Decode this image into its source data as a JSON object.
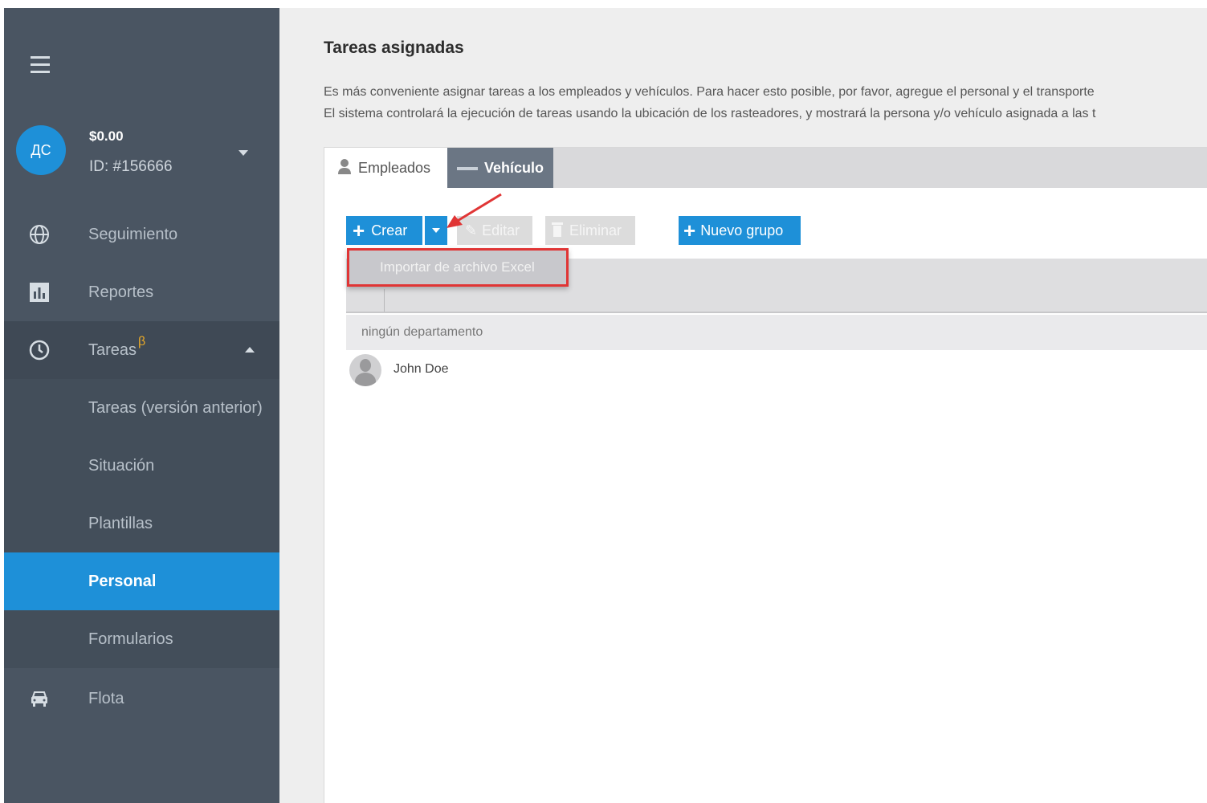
{
  "sidebar": {
    "avatar_initials": "ДС",
    "balance": "$0.00",
    "account_id": "ID: #156666",
    "items": [
      {
        "label": "Seguimiento",
        "icon": "globe-icon"
      },
      {
        "label": "Reportes",
        "icon": "bar-chart-icon"
      },
      {
        "label": "Tareas",
        "icon": "clock-icon",
        "badge": "β"
      },
      {
        "label": "Flota",
        "icon": "car-icon"
      }
    ],
    "subitems": [
      {
        "label": "Tareas (versión anterior)"
      },
      {
        "label": "Situación"
      },
      {
        "label": "Plantillas"
      },
      {
        "label": "Personal"
      },
      {
        "label": "Formularios"
      }
    ]
  },
  "main": {
    "title": "Tareas asignadas",
    "description_line1": "Es más conveniente asignar tareas a los empleados y vehículos. Para hacer esto posible, por favor, agregue el personal y el transporte",
    "description_line2": "El sistema controlará la ejecución de tareas usando la ubicación de los rasteadores, y mostrará la persona y/o vehículo asignada a las t",
    "tabs": [
      {
        "label": "Empleados",
        "icon": "person-icon"
      },
      {
        "label": "Vehículo",
        "icon": "truck-icon"
      }
    ],
    "toolbar": {
      "create_label": "Crear",
      "edit_label": "Editar",
      "delete_label": "Eliminar",
      "new_group_label": "Nuevo grupo"
    },
    "dropdown": {
      "import_label": "Importar de archivo Excel"
    },
    "group_row": "ningún departamento",
    "people": [
      {
        "name": "John Doe"
      }
    ]
  },
  "colors": {
    "accent": "#1e90d8",
    "sidebar_bg": "#4a5562",
    "annotation": "#e03535",
    "beta": "#e8a928"
  }
}
